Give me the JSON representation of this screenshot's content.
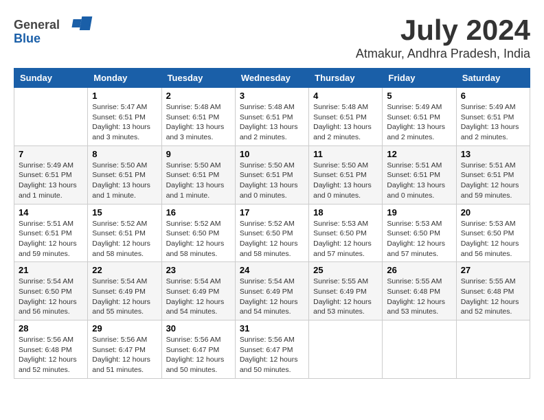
{
  "header": {
    "logo_general": "General",
    "logo_blue": "Blue",
    "month_title": "July 2024",
    "location": "Atmakur, Andhra Pradesh, India"
  },
  "calendar": {
    "weekdays": [
      "Sunday",
      "Monday",
      "Tuesday",
      "Wednesday",
      "Thursday",
      "Friday",
      "Saturday"
    ],
    "weeks": [
      [
        {
          "day": null,
          "sunrise": null,
          "sunset": null,
          "daylight": null
        },
        {
          "day": "1",
          "sunrise": "Sunrise: 5:47 AM",
          "sunset": "Sunset: 6:51 PM",
          "daylight": "Daylight: 13 hours and 3 minutes."
        },
        {
          "day": "2",
          "sunrise": "Sunrise: 5:48 AM",
          "sunset": "Sunset: 6:51 PM",
          "daylight": "Daylight: 13 hours and 3 minutes."
        },
        {
          "day": "3",
          "sunrise": "Sunrise: 5:48 AM",
          "sunset": "Sunset: 6:51 PM",
          "daylight": "Daylight: 13 hours and 2 minutes."
        },
        {
          "day": "4",
          "sunrise": "Sunrise: 5:48 AM",
          "sunset": "Sunset: 6:51 PM",
          "daylight": "Daylight: 13 hours and 2 minutes."
        },
        {
          "day": "5",
          "sunrise": "Sunrise: 5:49 AM",
          "sunset": "Sunset: 6:51 PM",
          "daylight": "Daylight: 13 hours and 2 minutes."
        },
        {
          "day": "6",
          "sunrise": "Sunrise: 5:49 AM",
          "sunset": "Sunset: 6:51 PM",
          "daylight": "Daylight: 13 hours and 2 minutes."
        }
      ],
      [
        {
          "day": "7",
          "sunrise": "Sunrise: 5:49 AM",
          "sunset": "Sunset: 6:51 PM",
          "daylight": "Daylight: 13 hours and 1 minute."
        },
        {
          "day": "8",
          "sunrise": "Sunrise: 5:50 AM",
          "sunset": "Sunset: 6:51 PM",
          "daylight": "Daylight: 13 hours and 1 minute."
        },
        {
          "day": "9",
          "sunrise": "Sunrise: 5:50 AM",
          "sunset": "Sunset: 6:51 PM",
          "daylight": "Daylight: 13 hours and 1 minute."
        },
        {
          "day": "10",
          "sunrise": "Sunrise: 5:50 AM",
          "sunset": "Sunset: 6:51 PM",
          "daylight": "Daylight: 13 hours and 0 minutes."
        },
        {
          "day": "11",
          "sunrise": "Sunrise: 5:50 AM",
          "sunset": "Sunset: 6:51 PM",
          "daylight": "Daylight: 13 hours and 0 minutes."
        },
        {
          "day": "12",
          "sunrise": "Sunrise: 5:51 AM",
          "sunset": "Sunset: 6:51 PM",
          "daylight": "Daylight: 13 hours and 0 minutes."
        },
        {
          "day": "13",
          "sunrise": "Sunrise: 5:51 AM",
          "sunset": "Sunset: 6:51 PM",
          "daylight": "Daylight: 12 hours and 59 minutes."
        }
      ],
      [
        {
          "day": "14",
          "sunrise": "Sunrise: 5:51 AM",
          "sunset": "Sunset: 6:51 PM",
          "daylight": "Daylight: 12 hours and 59 minutes."
        },
        {
          "day": "15",
          "sunrise": "Sunrise: 5:52 AM",
          "sunset": "Sunset: 6:51 PM",
          "daylight": "Daylight: 12 hours and 58 minutes."
        },
        {
          "day": "16",
          "sunrise": "Sunrise: 5:52 AM",
          "sunset": "Sunset: 6:50 PM",
          "daylight": "Daylight: 12 hours and 58 minutes."
        },
        {
          "day": "17",
          "sunrise": "Sunrise: 5:52 AM",
          "sunset": "Sunset: 6:50 PM",
          "daylight": "Daylight: 12 hours and 58 minutes."
        },
        {
          "day": "18",
          "sunrise": "Sunrise: 5:53 AM",
          "sunset": "Sunset: 6:50 PM",
          "daylight": "Daylight: 12 hours and 57 minutes."
        },
        {
          "day": "19",
          "sunrise": "Sunrise: 5:53 AM",
          "sunset": "Sunset: 6:50 PM",
          "daylight": "Daylight: 12 hours and 57 minutes."
        },
        {
          "day": "20",
          "sunrise": "Sunrise: 5:53 AM",
          "sunset": "Sunset: 6:50 PM",
          "daylight": "Daylight: 12 hours and 56 minutes."
        }
      ],
      [
        {
          "day": "21",
          "sunrise": "Sunrise: 5:54 AM",
          "sunset": "Sunset: 6:50 PM",
          "daylight": "Daylight: 12 hours and 56 minutes."
        },
        {
          "day": "22",
          "sunrise": "Sunrise: 5:54 AM",
          "sunset": "Sunset: 6:49 PM",
          "daylight": "Daylight: 12 hours and 55 minutes."
        },
        {
          "day": "23",
          "sunrise": "Sunrise: 5:54 AM",
          "sunset": "Sunset: 6:49 PM",
          "daylight": "Daylight: 12 hours and 54 minutes."
        },
        {
          "day": "24",
          "sunrise": "Sunrise: 5:54 AM",
          "sunset": "Sunset: 6:49 PM",
          "daylight": "Daylight: 12 hours and 54 minutes."
        },
        {
          "day": "25",
          "sunrise": "Sunrise: 5:55 AM",
          "sunset": "Sunset: 6:49 PM",
          "daylight": "Daylight: 12 hours and 53 minutes."
        },
        {
          "day": "26",
          "sunrise": "Sunrise: 5:55 AM",
          "sunset": "Sunset: 6:48 PM",
          "daylight": "Daylight: 12 hours and 53 minutes."
        },
        {
          "day": "27",
          "sunrise": "Sunrise: 5:55 AM",
          "sunset": "Sunset: 6:48 PM",
          "daylight": "Daylight: 12 hours and 52 minutes."
        }
      ],
      [
        {
          "day": "28",
          "sunrise": "Sunrise: 5:56 AM",
          "sunset": "Sunset: 6:48 PM",
          "daylight": "Daylight: 12 hours and 52 minutes."
        },
        {
          "day": "29",
          "sunrise": "Sunrise: 5:56 AM",
          "sunset": "Sunset: 6:47 PM",
          "daylight": "Daylight: 12 hours and 51 minutes."
        },
        {
          "day": "30",
          "sunrise": "Sunrise: 5:56 AM",
          "sunset": "Sunset: 6:47 PM",
          "daylight": "Daylight: 12 hours and 50 minutes."
        },
        {
          "day": "31",
          "sunrise": "Sunrise: 5:56 AM",
          "sunset": "Sunset: 6:47 PM",
          "daylight": "Daylight: 12 hours and 50 minutes."
        },
        {
          "day": null,
          "sunrise": null,
          "sunset": null,
          "daylight": null
        },
        {
          "day": null,
          "sunrise": null,
          "sunset": null,
          "daylight": null
        },
        {
          "day": null,
          "sunrise": null,
          "sunset": null,
          "daylight": null
        }
      ]
    ]
  }
}
